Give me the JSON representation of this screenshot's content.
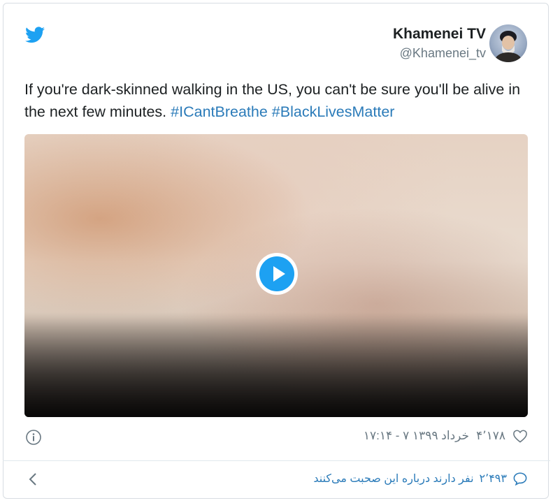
{
  "author": {
    "name": "Khamenei TV",
    "handle": "@Khamenei_tv"
  },
  "tweet": {
    "text": "If you're dark-skinned walking in the US, you can't be sure you'll be alive in the next few minutes.",
    "hashtags": [
      "#ICantBreathe",
      "#BlackLivesMatter"
    ]
  },
  "footer": {
    "likes": "۴٬۱۷۸",
    "timestamp": "۱۷:۱۴ - ۷ خرداد ۱۳۹۹",
    "conversation_count": "۲٬۴۹۳",
    "conversation_text": "نفر دارند درباره این صحبت می‌کنند"
  },
  "colors": {
    "brand": "#1da1f2",
    "link": "#2b7bb9",
    "meta_text": "#697882"
  },
  "icons": {
    "logo": "twitter-bird-icon",
    "play": "play-icon",
    "info": "info-icon",
    "like": "heart-icon",
    "reply": "speech-bubble-icon",
    "back": "chevron-left-icon"
  }
}
